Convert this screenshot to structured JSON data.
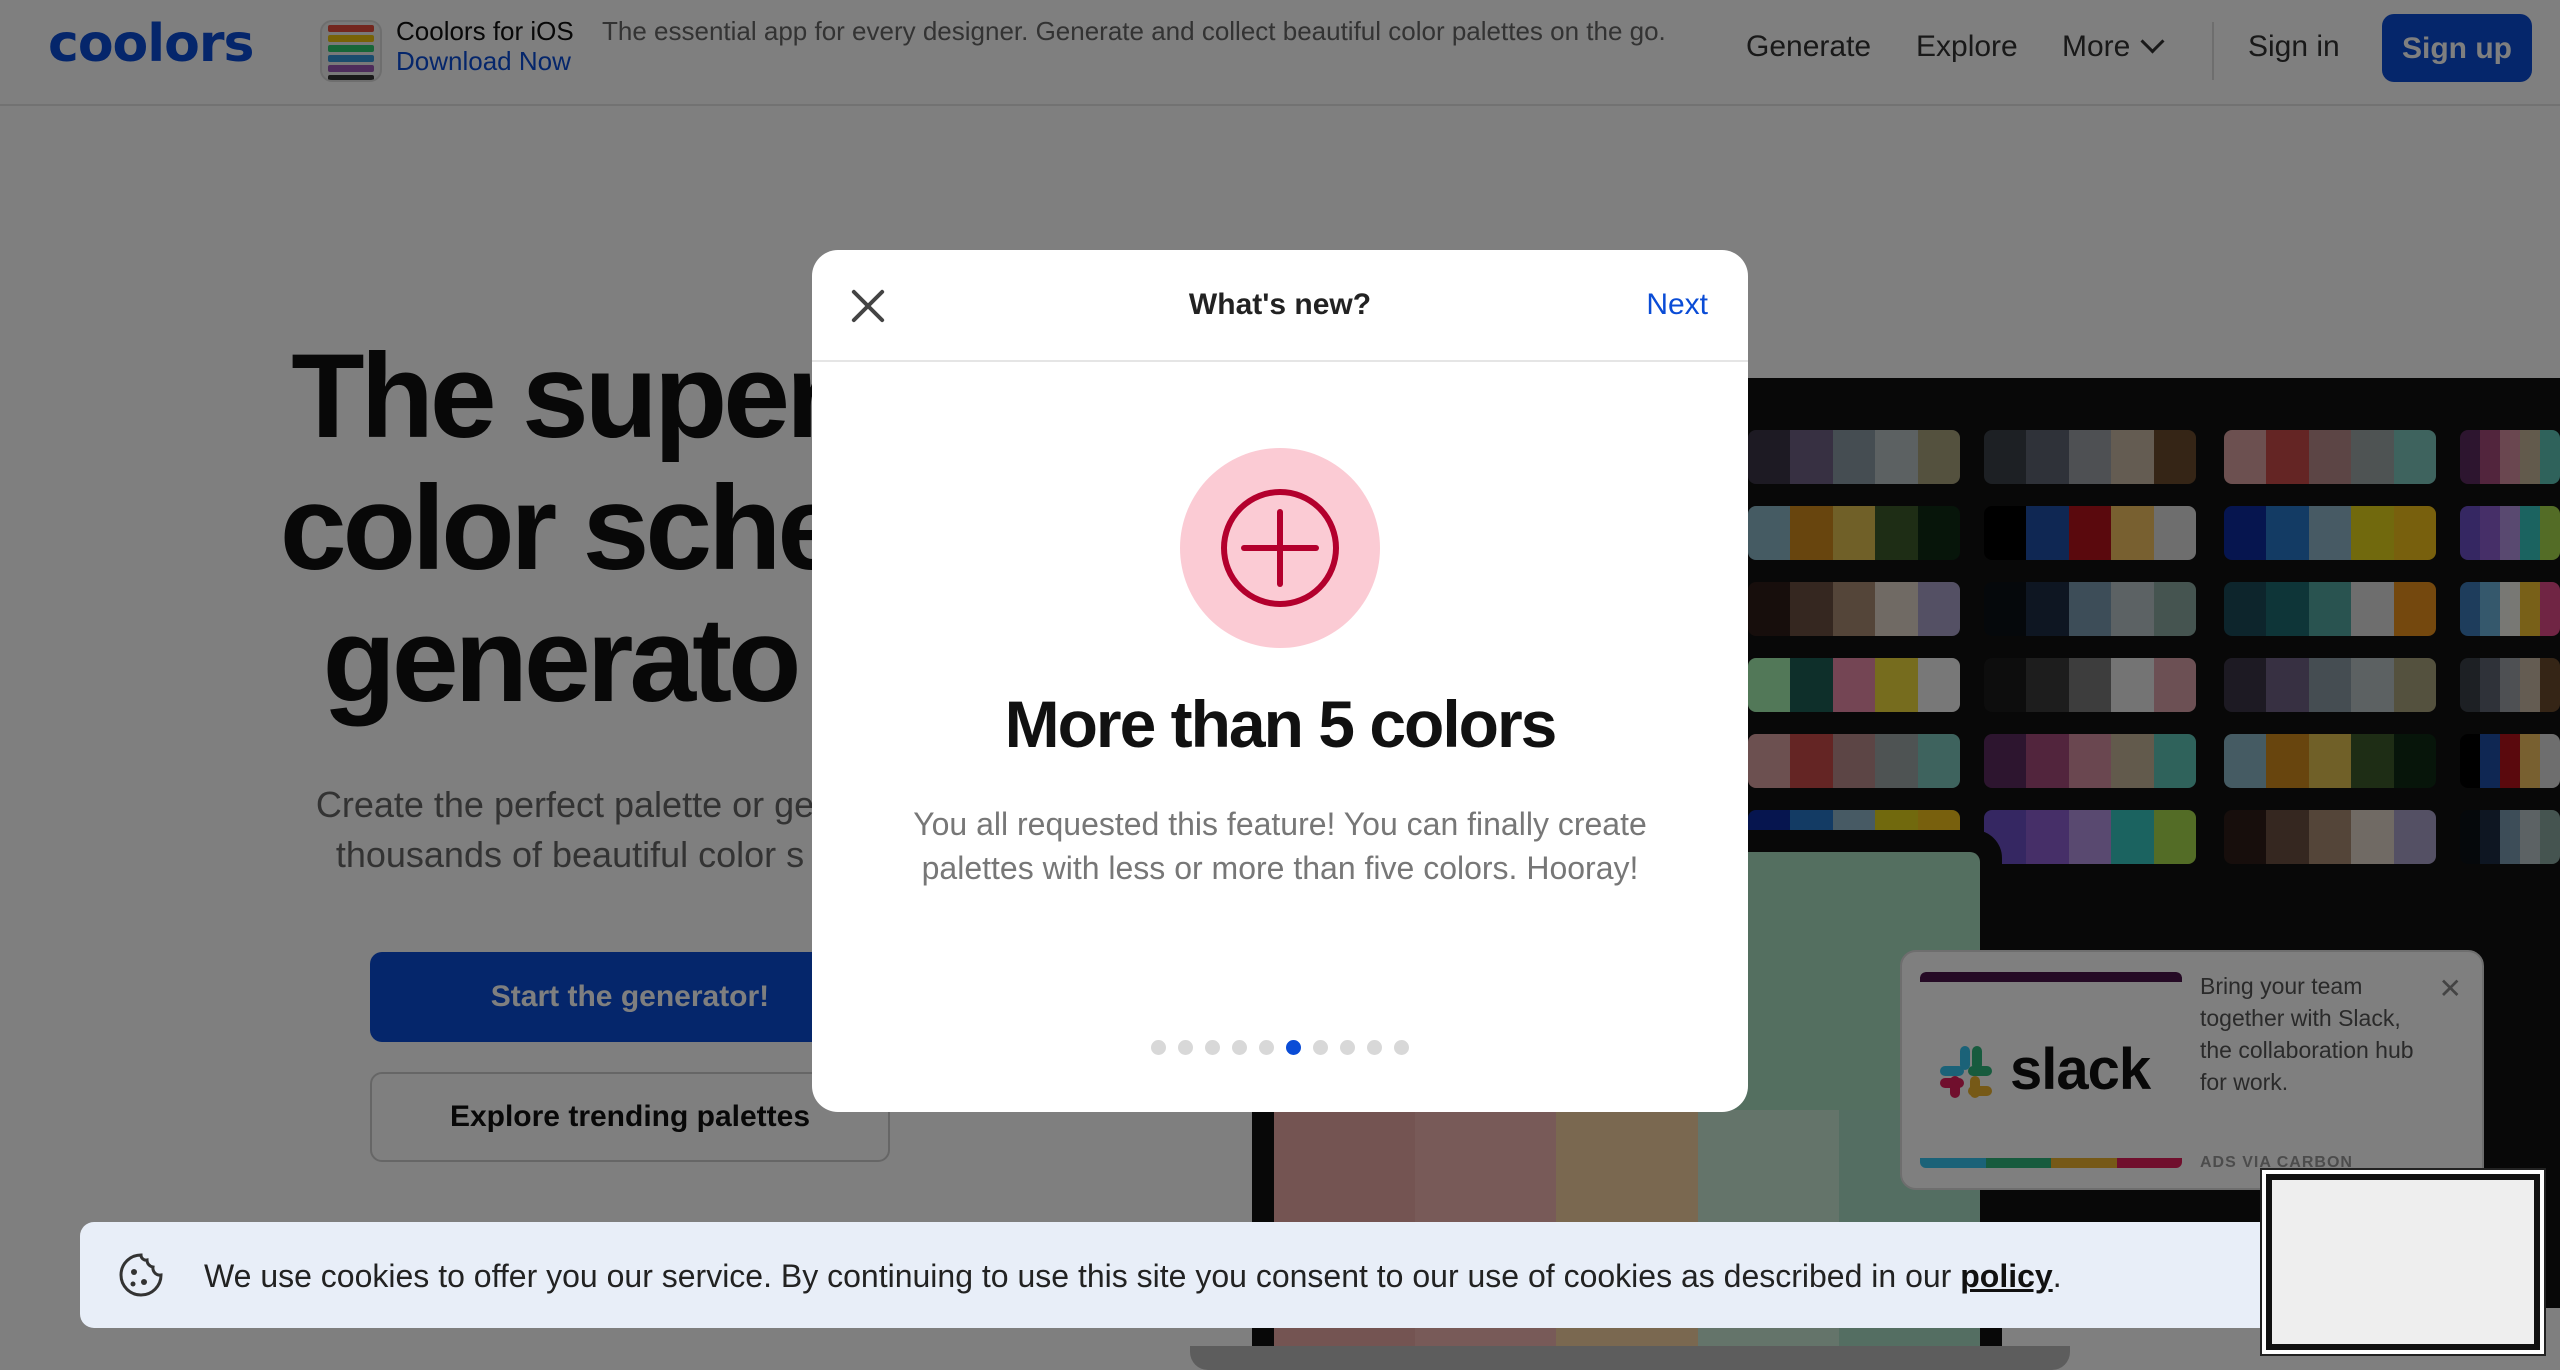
{
  "header": {
    "logo": "coolors",
    "ios_title": "Coolors for iOS",
    "ios_desc": "The essential app for every designer. Generate and collect beautiful color palettes on the go.",
    "ios_link": "Download Now",
    "nav": [
      "Generate",
      "Explore",
      "More"
    ],
    "signin": "Sign in",
    "signup": "Sign up"
  },
  "hero": {
    "title_line1": "The super",
    "title_line2": "color sche",
    "title_line3": "generato",
    "subtitle_line1": "Create the perfect palette or get",
    "subtitle_line2": "thousands of beautiful color s",
    "start_button": "Start the generator!",
    "explore_button": "Explore trending palettes"
  },
  "modal": {
    "title": "What's new?",
    "next": "Next",
    "feature_title": "More than 5 colors",
    "feature_desc": "You all requested this feature! You can finally create palettes with less or more than five colors. Hooray!",
    "page_count": 10,
    "active_page": 6,
    "accent": "#0a4cd6",
    "icon_color": "#b3002d",
    "icon_bg": "#fbcbd4"
  },
  "ad": {
    "brand": "slack",
    "text": "Bring your team together with Slack, the collaboration hub for work.",
    "via": "ADS VIA CARBON"
  },
  "cookie": {
    "text": "We use cookies to offer you our service. By continuing to use this site you consent to our use of cookies as described in our",
    "link": "policy",
    "end": "."
  },
  "palettes": [
    [
      "#3a3546",
      "#6e6184",
      "#8a9aa5",
      "#b9c2c4",
      "#a9a27c"
    ],
    [
      "#3b4048",
      "#5e6472",
      "#9da1a7",
      "#c8b8a4",
      "#6a4a2c"
    ],
    [
      "#d9a0a0",
      "#c94a48",
      "#b88a8a",
      "#9da7a6",
      "#7dc7bd"
    ],
    [
      "#5b2a5e",
      "#a54b7a",
      "#d48fa0",
      "#c4b598",
      "#5fc4b6"
    ],
    [
      "#8ab6c6",
      "#d08b1c",
      "#e0c050",
      "#3d5a2a",
      "#0e2a14"
    ],
    [
      "#000000",
      "#1f4fa6",
      "#b5121b",
      "#f0c060",
      "#dddddd"
    ],
    [
      "#0d2a9e",
      "#2676c9",
      "#8fb4c8",
      "#e3d31a",
      "#f0c01a"
    ],
    [
      "#6a4fc4",
      "#8d5fd1",
      "#b292e0",
      "#37c6c0",
      "#a6d84c"
    ],
    [
      "#2e1c18",
      "#6b4f40",
      "#a88a72",
      "#e0d4c8",
      "#a8a0c8"
    ],
    [
      "#0b1016",
      "#1c2c44",
      "#7a9ab0",
      "#b8c4c8",
      "#8aa8a0"
    ],
    [
      "#1a4a58",
      "#1c6a70",
      "#52a6a0",
      "#dddddd",
      "#e8901c"
    ],
    [
      "#3c7ab8",
      "#6ab0d8",
      "#f0f0e8",
      "#f0c030",
      "#e04a88"
    ],
    [
      "#a4f0b0",
      "#1c5f54",
      "#e88aa8",
      "#ecd83c",
      "#f0f0f0"
    ],
    [
      "#1a1a1a",
      "#3a3a3a",
      "#7a7a7a",
      "#e8e8e8",
      "#d8a0a8"
    ]
  ]
}
